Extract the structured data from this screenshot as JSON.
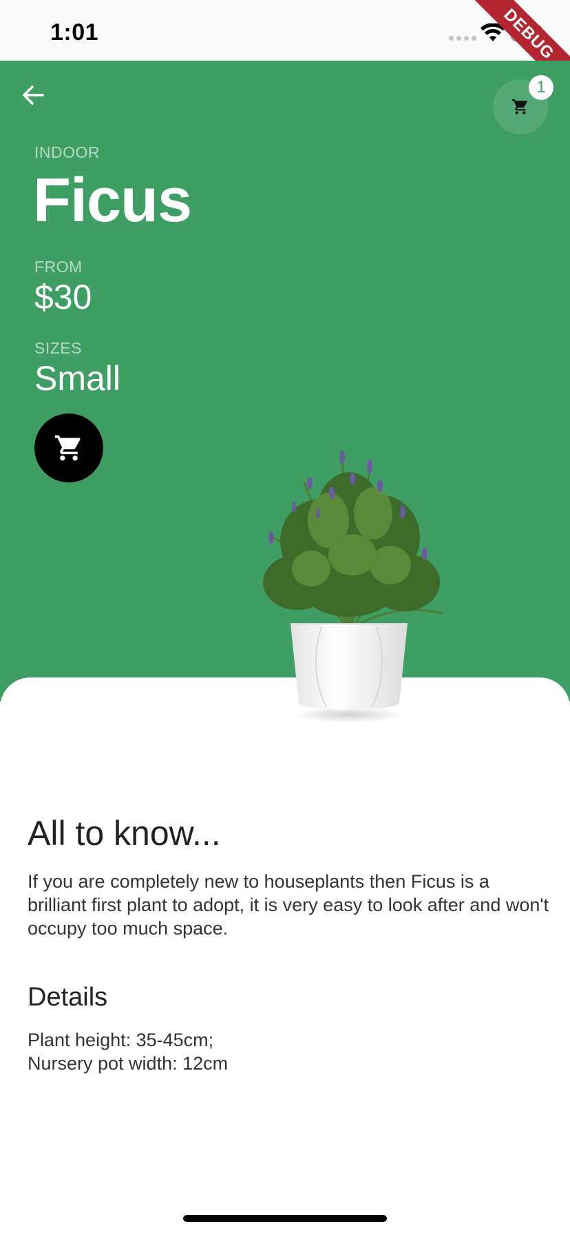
{
  "status_bar": {
    "time": "1:01",
    "debug_banner": "DEBUG"
  },
  "header": {
    "cart_count": "1"
  },
  "product": {
    "category": "INDOOR",
    "name": "Ficus",
    "price_label": "FROM",
    "price": "$30",
    "size_label": "SIZES",
    "size": "Small"
  },
  "colors": {
    "hero_background": "#3e9e64",
    "sheet_background": "#ffffff",
    "add_to_cart_button": "#000000",
    "debug_banner": "#b3262f"
  },
  "about": {
    "title": "All to know...",
    "text": "If you are completely new to houseplants then Ficus is a brilliant first plant to adopt, it is very easy to look after and won't occupy too much space."
  },
  "details": {
    "title": "Details",
    "items": [
      "Plant height: 35-45cm;",
      "Nursery pot width: 12cm"
    ]
  },
  "icons": {
    "back": "arrow-left-icon",
    "cart": "shopping-cart-icon",
    "add_to_cart": "shopping-cart-icon"
  }
}
